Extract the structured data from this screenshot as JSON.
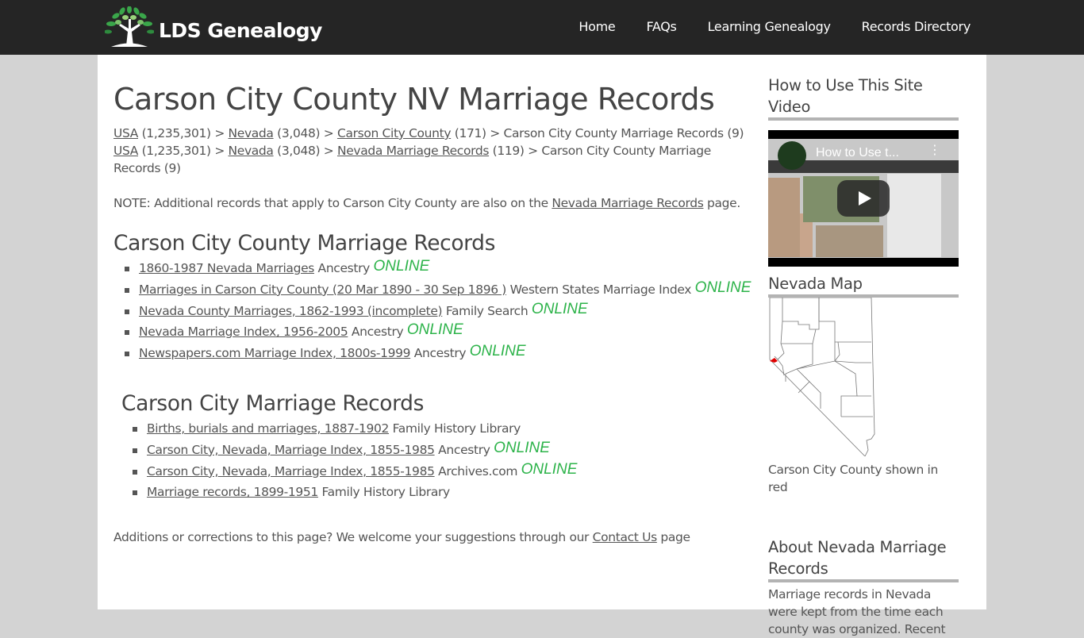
{
  "header": {
    "logo_text": "LDS Genealogy",
    "nav": [
      {
        "label": "Home"
      },
      {
        "label": "FAQs"
      },
      {
        "label": "Learning Genealogy"
      },
      {
        "label": "Records Directory"
      }
    ]
  },
  "main": {
    "title": "Carson City County NV Marriage Records",
    "breadcrumbs": [
      {
        "parts": [
          {
            "link": "USA",
            "count": " (1,235,301) > "
          },
          {
            "link": "Nevada",
            "count": " (3,048) > "
          },
          {
            "link": "Carson City County",
            "count": " (171) > "
          }
        ],
        "tail": "Carson City County Marriage Records (9)"
      },
      {
        "parts": [
          {
            "link": "USA",
            "count": " (1,235,301) > "
          },
          {
            "link": "Nevada",
            "count": " (3,048) > "
          },
          {
            "link": "Nevada Marriage Records",
            "count": " (119) > "
          }
        ],
        "tail": "Carson City County Marriage Records (9)"
      }
    ],
    "note": {
      "prefix": "NOTE: Additional records that apply to Carson City County are also on the ",
      "link": "Nevada Marriage Records",
      "suffix": " page."
    },
    "sections": [
      {
        "heading": "Carson City County Marriage Records",
        "items": [
          {
            "link": "1860-1987 Nevada Marriages",
            "source": " Ancestry ",
            "badge": "ONLINE"
          },
          {
            "link": "Marriages in Carson City County (20 Mar 1890 - 30 Sep 1896 )",
            "source": " Western States Marriage Index ",
            "badge": "ONLINE"
          },
          {
            "link": "Nevada County Marriages, 1862-1993 (incomplete)",
            "source": " Family Search ",
            "badge": "ONLINE"
          },
          {
            "link": "Nevada Marriage Index, 1956-2005",
            "source": " Ancestry ",
            "badge": "ONLINE"
          },
          {
            "link": "Newspapers.com Marriage Index, 1800s-1999",
            "source": " Ancestry ",
            "badge": "ONLINE"
          }
        ]
      },
      {
        "heading": "Carson City Marriage Records",
        "items": [
          {
            "link": "Births, burials and marriages, 1887-1902",
            "source": " Family History Library",
            "badge": ""
          },
          {
            "link": "Carson City, Nevada, Marriage Index, 1855-1985",
            "source": " Ancestry ",
            "badge": "ONLINE"
          },
          {
            "link": "Carson City, Nevada, Marriage Index, 1855-1985",
            "source": " Archives.com ",
            "badge": "ONLINE"
          },
          {
            "link": "Marriage records, 1899-1951",
            "source": " Family History Library",
            "badge": ""
          }
        ]
      }
    ],
    "footer": {
      "prefix": "Additions or corrections to this page? We welcome your suggestions through our ",
      "link": "Contact Us",
      "suffix": " page"
    }
  },
  "sidebar": {
    "video_heading": "How to Use This Site Video",
    "video_title": "How to Use t...",
    "map_heading": "Nevada Map",
    "map_caption": "Carson City County shown in red",
    "highlight_color": "#e00000",
    "about_heading": "About Nevada Marriage Records",
    "about_text": "Marriage records in Nevada were kept from the time each county was organized. Recent"
  },
  "colors": {
    "header_bg": "#252525",
    "online_badge": "#2db34a",
    "page_bg": "#d3d3d3"
  }
}
